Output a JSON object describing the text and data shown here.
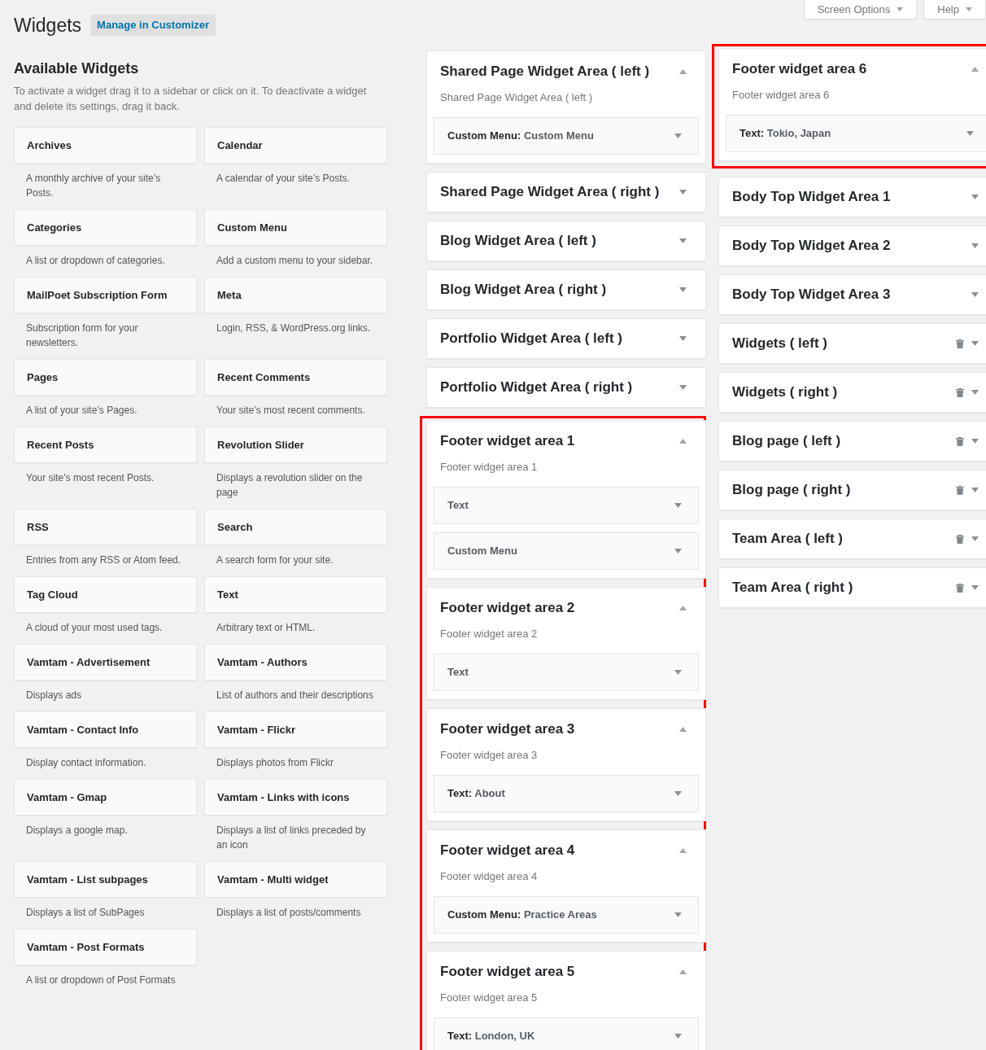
{
  "screen_meta": [
    {
      "label": "Screen Options"
    },
    {
      "label": "Help"
    }
  ],
  "page_title": "Widgets",
  "customizer_button": "Manage in Customizer",
  "available_widgets": {
    "heading": "Available Widgets",
    "description": "To activate a widget drag it to a sidebar or click on it. To deactivate a widget and delete its settings, drag it back.",
    "widgets": [
      {
        "name": "Archives",
        "description": "A monthly archive of your site’s Posts."
      },
      {
        "name": "Calendar",
        "description": "A calendar of your site’s Posts."
      },
      {
        "name": "Categories",
        "description": "A list or dropdown of categories."
      },
      {
        "name": "Custom Menu",
        "description": "Add a custom menu to your sidebar."
      },
      {
        "name": "MailPoet Subscription Form",
        "description": "Subscription form for your newsletters."
      },
      {
        "name": "Meta",
        "description": "Login, RSS, & WordPress.org links."
      },
      {
        "name": "Pages",
        "description": "A list of your site’s Pages."
      },
      {
        "name": "Recent Comments",
        "description": "Your site’s most recent comments."
      },
      {
        "name": "Recent Posts",
        "description": "Your site’s most recent Posts."
      },
      {
        "name": "Revolution Slider",
        "description": "Displays a revolution slider on the page"
      },
      {
        "name": "RSS",
        "description": "Entries from any RSS or Atom feed."
      },
      {
        "name": "Search",
        "description": "A search form for your site."
      },
      {
        "name": "Tag Cloud",
        "description": "A cloud of your most used tags."
      },
      {
        "name": "Text",
        "description": "Arbitrary text or HTML."
      },
      {
        "name": "Vamtam - Advertisement",
        "description": "Displays ads"
      },
      {
        "name": "Vamtam - Authors",
        "description": "List of authors and their descriptions"
      },
      {
        "name": "Vamtam - Contact Info",
        "description": "Display contact information."
      },
      {
        "name": "Vamtam - Flickr",
        "description": "Displays photos from Flickr"
      },
      {
        "name": "Vamtam - Gmap",
        "description": "Displays a google map."
      },
      {
        "name": "Vamtam - Links with icons",
        "description": "Displays a list of links preceded by an icon"
      },
      {
        "name": "Vamtam - List subpages",
        "description": "Displays a list of SubPages"
      },
      {
        "name": "Vamtam - Multi widget",
        "description": "Displays a list of posts/comments"
      },
      {
        "name": "Vamtam - Post Formats",
        "description": "A list or dropdown of Post Formats"
      }
    ]
  },
  "sidebar_columns": [
    {
      "groups": [
        {
          "highlighted": false,
          "sidebars": [
            {
              "title": "Shared Page Widget Area ( left )",
              "expanded": true,
              "deletable": false,
              "description": "Shared Page Widget Area ( left )",
              "widgets": [
                {
                  "title": "**Custom Menu:** Custom Menu"
                }
              ]
            },
            {
              "title": "Shared Page Widget Area ( right )",
              "expanded": false,
              "deletable": false
            },
            {
              "title": "Blog Widget Area ( left )",
              "expanded": false,
              "deletable": false
            },
            {
              "title": "Blog Widget Area ( right )",
              "expanded": false,
              "deletable": false
            },
            {
              "title": "Portfolio Widget Area ( left )",
              "expanded": false,
              "deletable": false
            },
            {
              "title": "Portfolio Widget Area ( right )",
              "expanded": false,
              "deletable": false
            }
          ]
        },
        {
          "highlighted": true,
          "sidebars": [
            {
              "title": "Footer widget area 1",
              "expanded": true,
              "deletable": false,
              "description": "Footer widget area 1",
              "widgets": [
                {
                  "title": "Text"
                },
                {
                  "title": "Custom Menu"
                }
              ]
            },
            {
              "title": "Footer widget area 2",
              "expanded": true,
              "deletable": false,
              "description": "Footer widget area 2",
              "widgets": [
                {
                  "title": "Text"
                }
              ]
            },
            {
              "title": "Footer widget area 3",
              "expanded": true,
              "deletable": false,
              "description": "Footer widget area 3",
              "widgets": [
                {
                  "title": "**Text:** About"
                }
              ]
            },
            {
              "title": "Footer widget area 4",
              "expanded": true,
              "deletable": false,
              "description": "Footer widget area 4",
              "widgets": [
                {
                  "title": "**Custom Menu:** Practice Areas"
                }
              ]
            },
            {
              "title": "Footer widget area 5",
              "expanded": true,
              "deletable": false,
              "description": "Footer widget area 5",
              "widgets": [
                {
                  "title": "**Text:** London, UK"
                }
              ]
            }
          ]
        }
      ]
    },
    {
      "groups": [
        {
          "highlighted": true,
          "sidebars": [
            {
              "title": "Footer widget area 6",
              "expanded": true,
              "deletable": false,
              "description": "Footer widget area 6",
              "widgets": [
                {
                  "title": "**Text:** Tokio, Japan"
                }
              ]
            }
          ]
        },
        {
          "highlighted": false,
          "sidebars": [
            {
              "title": "Body Top Widget Area 1",
              "expanded": false,
              "deletable": false
            },
            {
              "title": "Body Top Widget Area 2",
              "expanded": false,
              "deletable": false
            },
            {
              "title": "Body Top Widget Area 3",
              "expanded": false,
              "deletable": false
            },
            {
              "title": "Widgets ( left )",
              "expanded": false,
              "deletable": true
            },
            {
              "title": "Widgets ( right )",
              "expanded": false,
              "deletable": true
            },
            {
              "title": "Blog page ( left )",
              "expanded": false,
              "deletable": true
            },
            {
              "title": "Blog page ( right )",
              "expanded": false,
              "deletable": true
            },
            {
              "title": "Team Area ( left )",
              "expanded": false,
              "deletable": true
            },
            {
              "title": "Team Area ( right )",
              "expanded": false,
              "deletable": true
            }
          ]
        }
      ]
    }
  ]
}
